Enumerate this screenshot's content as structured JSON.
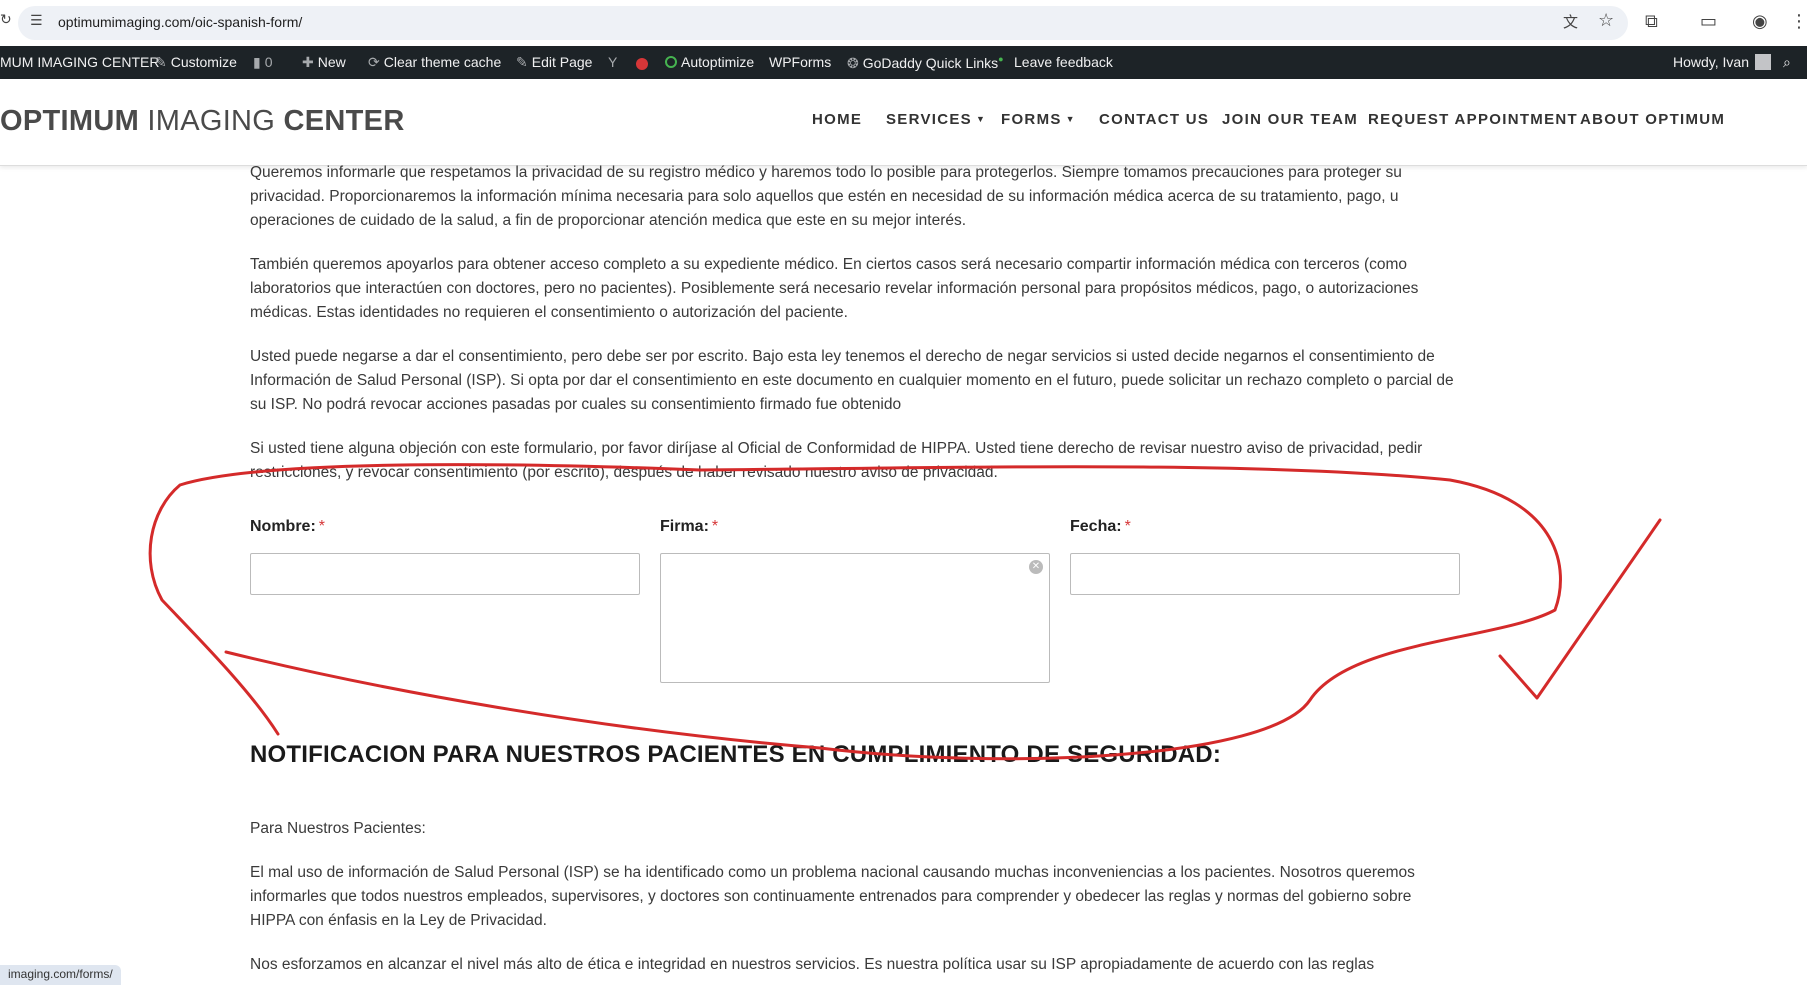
{
  "browser": {
    "url": "optimumimaging.com/oic-spanish-form/"
  },
  "admin_bar": {
    "site_name": "MUM IMAGING CENTER",
    "customize": "Customize",
    "comments_count": "0",
    "new": "New",
    "clear_cache": "Clear theme cache",
    "edit_page": "Edit Page",
    "autoptimize": "Autoptimize",
    "wpforms": "WPForms",
    "godaddy": "GoDaddy Quick Links",
    "leave_feedback": "Leave feedback",
    "howdy": "Howdy, Ivan"
  },
  "header": {
    "logo_bold_1": "OPTIMUM",
    "logo_light": " IMAGING ",
    "logo_bold_2": "CENTER",
    "nav": {
      "home": "HOME",
      "services": "SERVICES",
      "forms": "FORMS",
      "contact": "CONTACT US",
      "join": "JOIN OUR TEAM",
      "request": "REQUEST APPOINTMENT",
      "about": "ABOUT OPTIMUM"
    }
  },
  "content": {
    "p1": "Queremos informarle que respetamos la privacidad de su registro médico y haremos todo lo posible para protegerlos. Siempre tomamos precauciones para proteger su privacidad. Proporcionaremos la información mínima necesaria para solo aquellos que estén en necesidad de su información médica acerca de su tratamiento, pago, u operaciones de cuidado de la salud, a fin de proporcionar atención medica que este en su mejor interés.",
    "p2": "También queremos apoyarlos para obtener acceso completo a su expediente médico. En ciertos casos será necesario compartir información médica con terceros (como laboratorios que interactúen con doctores, pero no pacientes). Posiblemente será necesario revelar información personal para propósitos médicos, pago, o autorizaciones médicas. Estas identidades no requieren el consentimiento o autorización del paciente.",
    "p3": "Usted puede negarse a dar el consentimiento, pero debe ser por escrito. Bajo esta ley tenemos el derecho de negar servicios si usted decide negarnos el consentimiento de Información de Salud Personal (ISP). Si opta por dar el consentimiento en este documento en cualquier momento en el futuro, puede solicitar un rechazo completo o parcial de su ISP. No podrá revocar acciones pasadas por cuales su consentimiento firmado fue obtenido",
    "p4": "Si usted tiene alguna objeción con este formulario, por favor diríjase al Oficial de Conformidad de HIPPA. Usted tiene derecho de revisar nuestro aviso de privacidad, pedir restricciones, y revocar consentimiento (por escrito), después de haber revisado nuestro aviso de privacidad.",
    "form": {
      "nombre_label": "Nombre:",
      "firma_label": "Firma:",
      "fecha_label": "Fecha:",
      "required_mark": "*"
    },
    "heading": "NOTIFICACION PARA NUESTROS PACIENTES EN CUMPLIMIENTO DE SEGURIDAD:",
    "p5": "Para Nuestros Pacientes:",
    "p6": "El mal uso de información de Salud Personal (ISP) se ha identificado como un problema nacional causando muchas inconveniencias a los pacientes. Nosotros queremos informarles que todos nuestros empleados, supervisores, y doctores son continuamente entrenados para comprender y obedecer las reglas y normas del gobierno sobre HIPPA con énfasis en la Ley de Privacidad.",
    "p7": "Nos esforzamos en alcanzar el nivel más alto de ética e integridad en nuestros servicios. Es nuestra política usar su ISP apropiadamente de acuerdo con las reglas"
  },
  "status_bar": {
    "link": "imaging.com/forms/"
  },
  "colors": {
    "admin_bar": "#1d2327",
    "annotation": "#d42a2a",
    "required": "#d63638"
  }
}
